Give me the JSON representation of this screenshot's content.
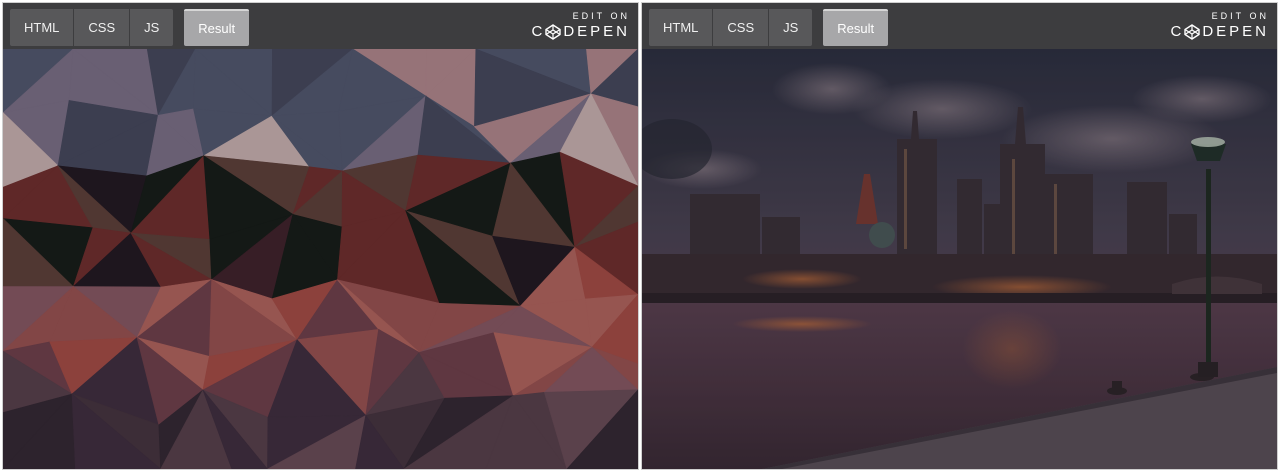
{
  "panes": [
    {
      "tabs": {
        "html": "HTML",
        "css": "CSS",
        "js": "JS",
        "result": "Result"
      },
      "codepen": {
        "small": "EDIT ON",
        "big": "C",
        "big_rest": "DEPEN",
        "icon": "codepen-logo-icon"
      }
    },
    {
      "tabs": {
        "html": "HTML",
        "css": "CSS",
        "js": "JS",
        "result": "Result"
      },
      "codepen": {
        "small": "EDIT ON",
        "big": "C",
        "big_rest": "DEPEN",
        "icon": "codepen-logo-icon"
      }
    }
  ]
}
